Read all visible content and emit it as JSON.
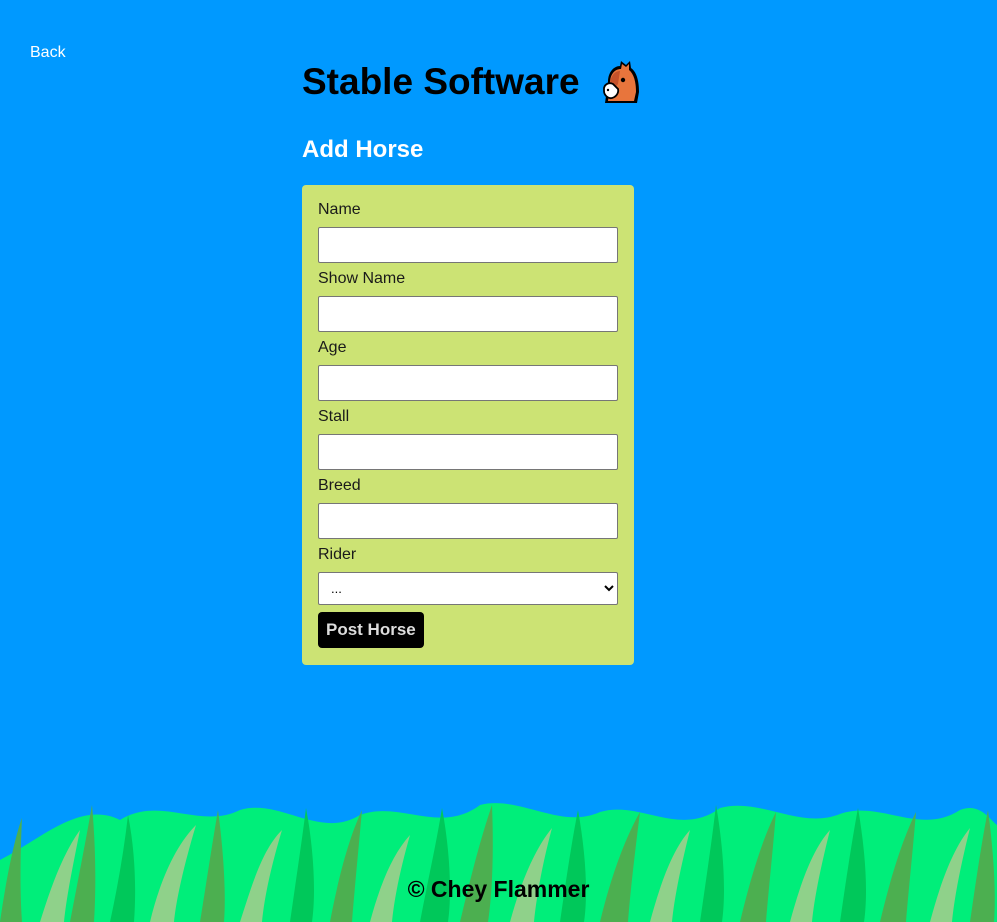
{
  "nav": {
    "back_label": "Back"
  },
  "header": {
    "title": "Stable Software",
    "logo_icon": "horse-face-icon"
  },
  "form": {
    "heading": "Add Horse",
    "fields": [
      {
        "label": "Name",
        "value": ""
      },
      {
        "label": "Show Name",
        "value": ""
      },
      {
        "label": "Age",
        "value": ""
      },
      {
        "label": "Stall",
        "value": ""
      },
      {
        "label": "Breed",
        "value": ""
      }
    ],
    "rider": {
      "label": "Rider",
      "selected": "..."
    },
    "submit_label": "Post Horse"
  },
  "footer": {
    "text": "© Chey Flammer"
  },
  "colors": {
    "background": "#0099ff",
    "form_card": "#cce374",
    "button": "#000000",
    "grass_light": "#00ee7a",
    "grass_dark": "#4caf50"
  }
}
